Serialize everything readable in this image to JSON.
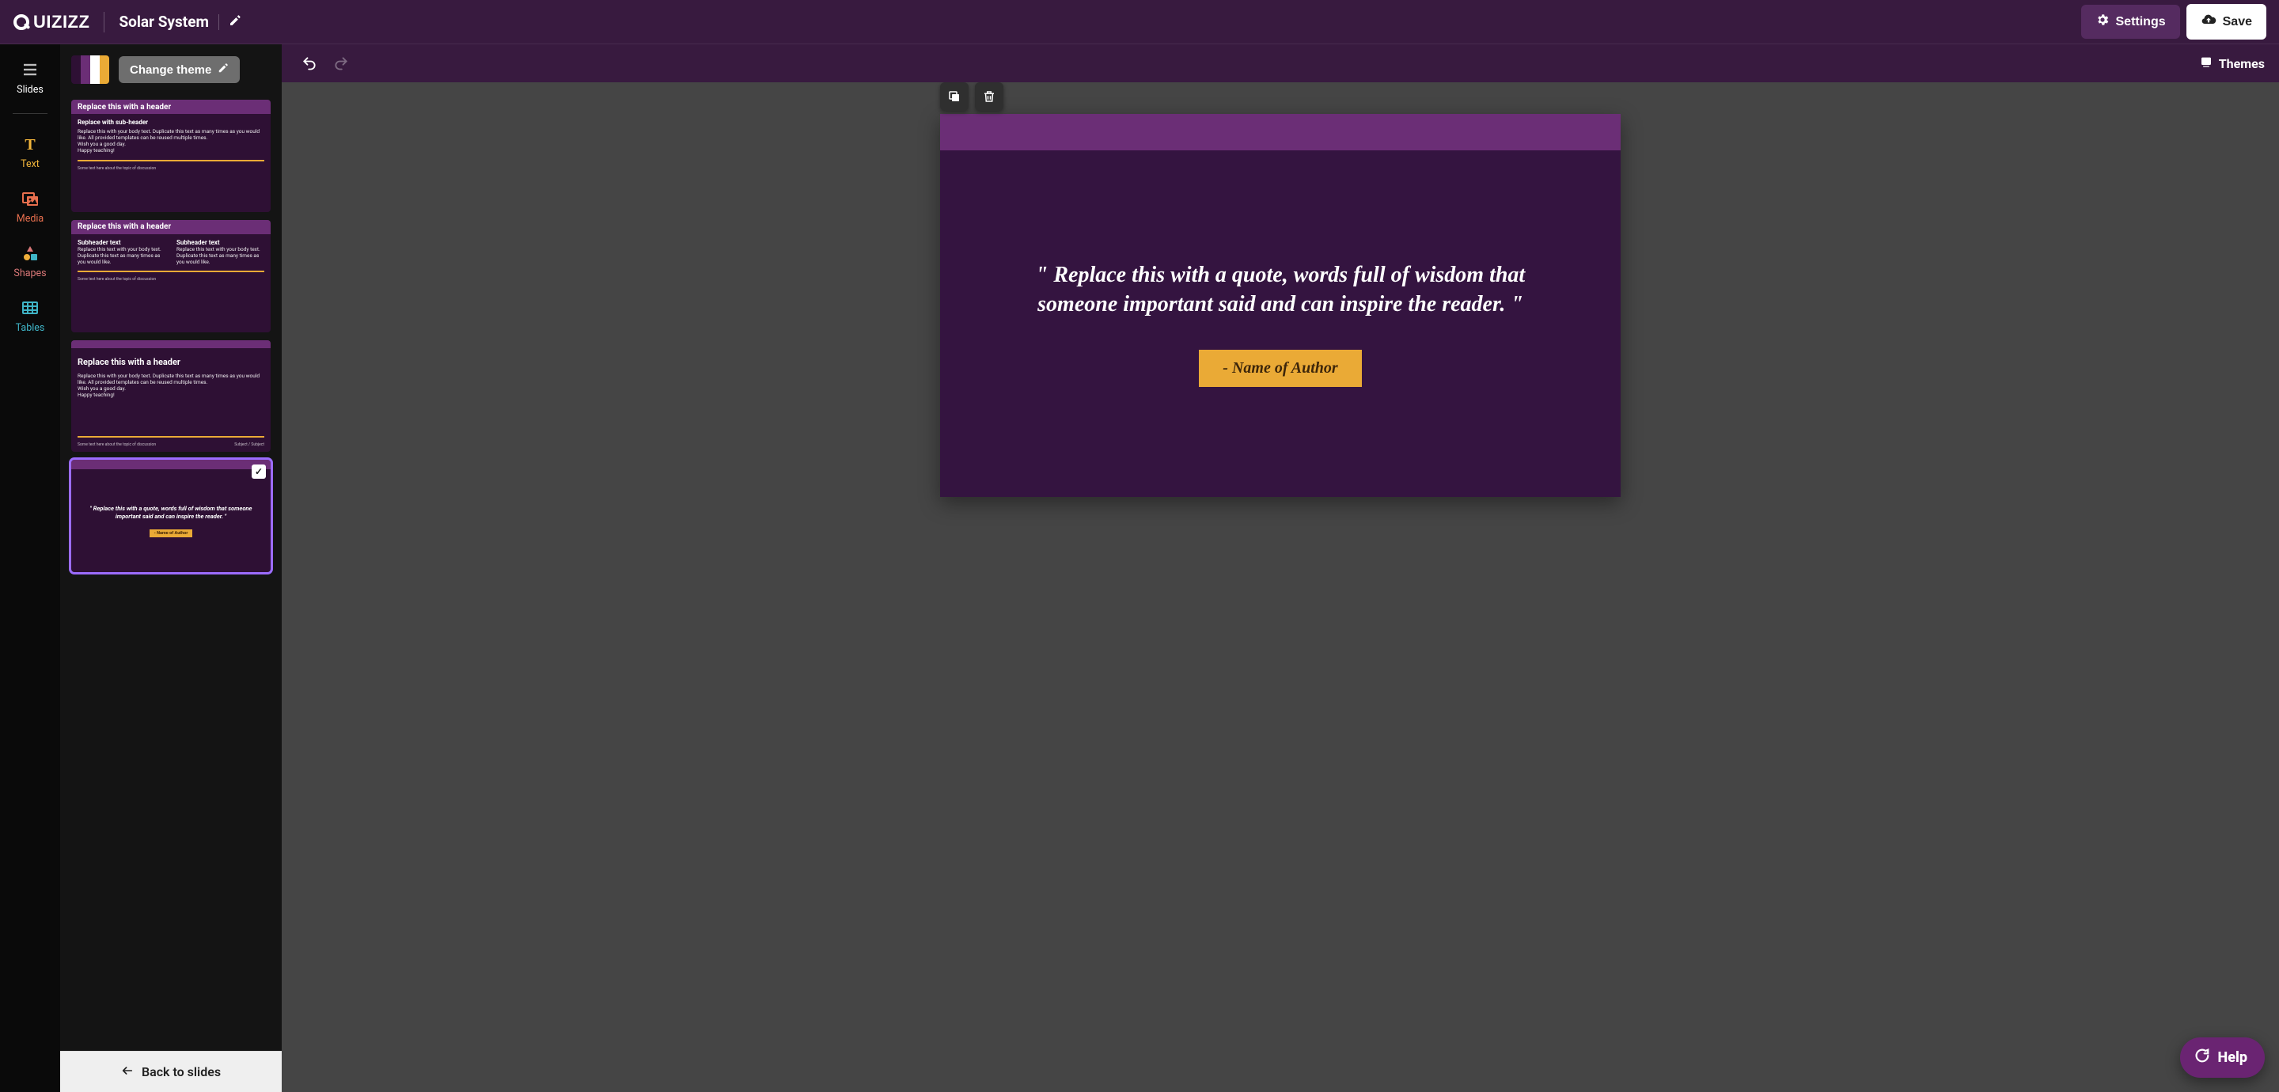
{
  "header": {
    "logo_text": "QUIZIZZ",
    "doc_title": "Solar System",
    "settings_label": "Settings",
    "save_label": "Save"
  },
  "rail": {
    "items": [
      {
        "label": "Slides",
        "icon": "slides"
      },
      {
        "label": "Text",
        "icon": "text"
      },
      {
        "label": "Media",
        "icon": "media"
      },
      {
        "label": "Shapes",
        "icon": "shapes"
      },
      {
        "label": "Tables",
        "icon": "tables"
      }
    ]
  },
  "panel": {
    "change_theme_label": "Change theme",
    "swatch": [
      "#2E1034",
      "#6B2E76",
      "#FFFFFF",
      "#EAAA36"
    ],
    "back_label": "Back to slides",
    "thumbs": [
      {
        "header": "Replace this with a header",
        "sub": "Replace with sub-header",
        "body": "Replace this with your body text. Duplicate this text as many times as you would like. All provided templates can be reused multiple times.\nWish you a good day.\nHappy teaching!",
        "footer_left": "Some text here about the topic of discussion"
      },
      {
        "header": "Replace this with a header",
        "col1_sub": "Subheader text",
        "col1_body": "Replace this text with your body text.\nDuplicate this text as many times as you would like.",
        "col2_sub": "Subheader text",
        "col2_body": "Replace this text with your body text.\nDuplicate this text as many times as you would like.",
        "footer_left": "Some text here about the topic of discussion"
      },
      {
        "header": "Replace this with a header",
        "body": "Replace this with your body text. Duplicate this text as many times as you would like. All provided templates can be reused multiple times.\nWish you a good day.\nHappy teaching!",
        "footer_left": "Some text here about the topic of discussion",
        "footer_right": "Subject / Subject"
      },
      {
        "quote": "\" Replace this with a quote, words full of wisdom that someone important said and can inspire the reader. \"",
        "author": "- Name of Author"
      }
    ]
  },
  "canvas": {
    "themes_label": "Themes",
    "slide": {
      "quote": "\" Replace this with a quote, words full of wisdom that someone important said and can inspire the reader. \"",
      "author": "- Name of Author"
    }
  },
  "help": {
    "label": "Help"
  }
}
